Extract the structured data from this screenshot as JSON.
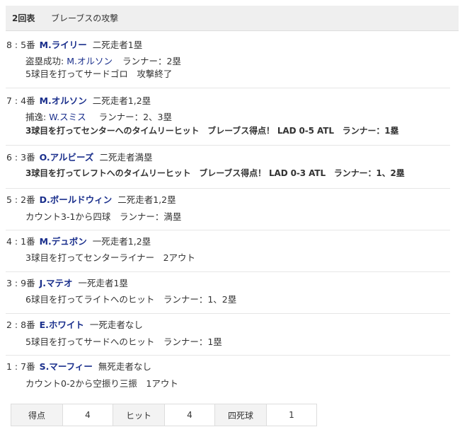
{
  "header": {
    "inning": "2回表",
    "team_attack": "ブレーブスの攻撃"
  },
  "plays": [
    {
      "order": "8",
      "bat": "5番",
      "player": "M.ライリー",
      "situation": "二死走者1塁",
      "lines": [
        {
          "parts": [
            {
              "t": "盗塁成功: ",
              "k": "plain"
            },
            {
              "t": "M.オルソン",
              "k": "link"
            },
            {
              "t": "ランナー：2塁",
              "k": "plain",
              "gap": 14
            }
          ]
        },
        {
          "parts": [
            {
              "t": "5球目を打ってサードゴロ　攻撃終了",
              "k": "plain"
            }
          ]
        }
      ]
    },
    {
      "order": "7",
      "bat": "4番",
      "player": "M.オルソン",
      "situation": "二死走者1,2塁",
      "lines": [
        {
          "parts": [
            {
              "t": "捕逸: ",
              "k": "plain"
            },
            {
              "t": "W.スミス",
              "k": "link"
            },
            {
              "t": "ランナー：2、3塁",
              "k": "plain",
              "gap": 18
            }
          ]
        },
        {
          "bold": true,
          "parts": [
            {
              "t": "3球目を打ってセンターへのタイムリーヒット　ブレーブス得点！ LAD 0-5 ATL　ランナー：1塁",
              "k": "plain"
            }
          ]
        }
      ]
    },
    {
      "order": "6",
      "bat": "3番",
      "player": "O.アルビーズ",
      "situation": "二死走者満塁",
      "lines": [
        {
          "bold": true,
          "parts": [
            {
              "t": "3球目を打ってレフトへのタイムリーヒット　ブレーブス得点！ LAD 0-3 ATL　ランナー：1、2塁",
              "k": "plain"
            }
          ]
        }
      ]
    },
    {
      "order": "5",
      "bat": "2番",
      "player": "D.ボールドウィン",
      "situation": "二死走者1,2塁",
      "lines": [
        {
          "parts": [
            {
              "t": "カウント3-1から四球　ランナー：満塁",
              "k": "plain"
            }
          ]
        }
      ]
    },
    {
      "order": "4",
      "bat": "1番",
      "player": "M.デュボン",
      "situation": "一死走者1,2塁",
      "lines": [
        {
          "parts": [
            {
              "t": "3球目を打ってセンターライナー　2アウト",
              "k": "plain"
            }
          ]
        }
      ]
    },
    {
      "order": "3",
      "bat": "9番",
      "player": "J.マテオ",
      "situation": "一死走者1塁",
      "lines": [
        {
          "parts": [
            {
              "t": "6球目を打ってライトへのヒット　ランナー：1、2塁",
              "k": "plain"
            }
          ]
        }
      ]
    },
    {
      "order": "2",
      "bat": "8番",
      "player": "E.ホワイト",
      "situation": "一死走者なし",
      "lines": [
        {
          "parts": [
            {
              "t": "5球目を打ってサードへのヒット　ランナー：1塁",
              "k": "plain"
            }
          ]
        }
      ]
    },
    {
      "order": "1",
      "bat": "7番",
      "player": "S.マーフィー",
      "situation": "無死走者なし",
      "lines": [
        {
          "parts": [
            {
              "t": "カウント0-2から空振り三振　1アウト",
              "k": "plain"
            }
          ]
        }
      ]
    }
  ],
  "summary": [
    {
      "label": "得点",
      "value": "4"
    },
    {
      "label": "ヒット",
      "value": "4"
    },
    {
      "label": "四死球",
      "value": "1"
    }
  ]
}
